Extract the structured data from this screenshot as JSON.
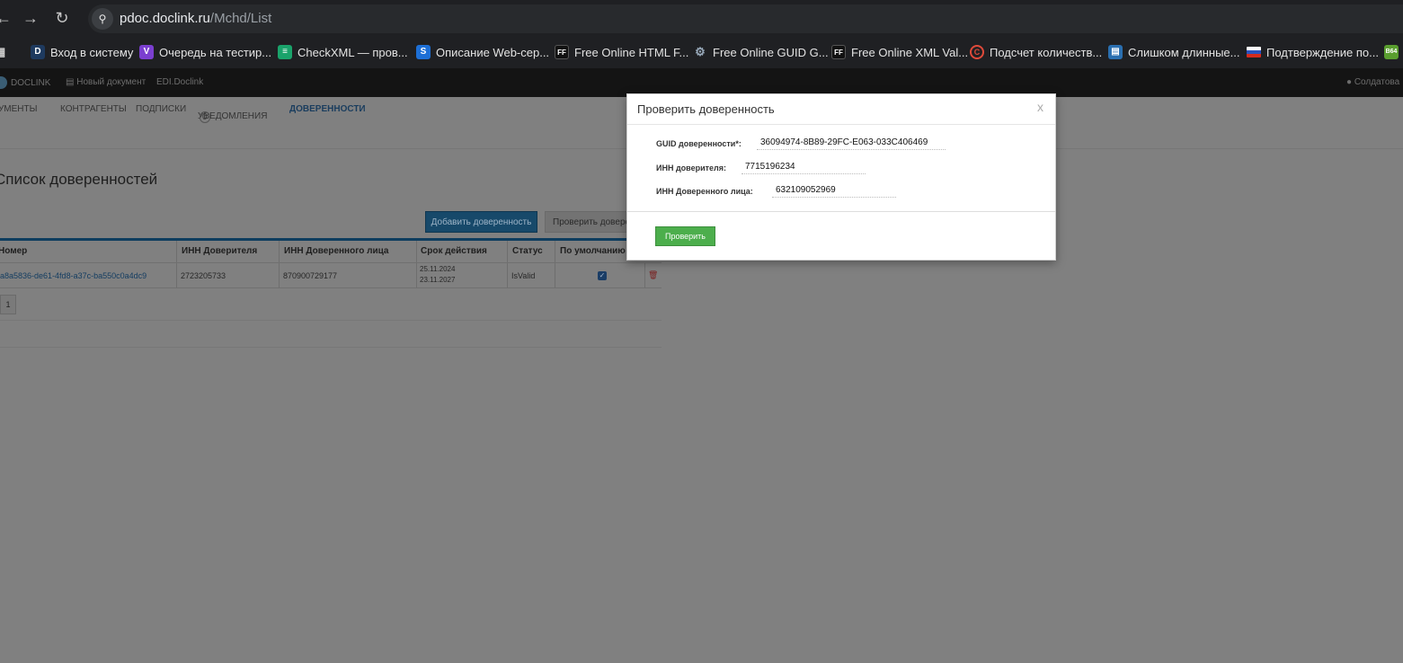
{
  "browser": {
    "url_host": "pdoc.doclink.ru",
    "url_path": "/Mchd/List",
    "bookmarks": [
      {
        "label": "Вход в систему",
        "icon": "D",
        "color": "#1e3a5f"
      },
      {
        "label": "Очередь на тестир...",
        "icon": "V",
        "color": "#7b3fd0"
      },
      {
        "label": "CheckXML — пров...",
        "icon": "≡",
        "color": "#1aa36b"
      },
      {
        "label": "Описание Web-сер...",
        "icon": "S",
        "color": "#1d6fd6"
      },
      {
        "label": "Free Online HTML F...",
        "icon": "FF",
        "color": "#111111"
      },
      {
        "label": "Free Online GUID G...",
        "icon": "⚙",
        "color": "#1f2023"
      },
      {
        "label": "Free Online XML Val...",
        "icon": "FF",
        "color": "#111111"
      },
      {
        "label": "Подсчет количеств...",
        "icon": "C",
        "color": "#c0392b"
      },
      {
        "label": "Слишком длинные...",
        "icon": "▤",
        "color": "#2a6fb0"
      },
      {
        "label": "Подтверждение по...",
        "icon": "",
        "color": "#d33"
      },
      {
        "label": "",
        "icon": "B64",
        "color": "#5a9e2f"
      }
    ]
  },
  "app": {
    "brand": "DOCLINK",
    "new_doc": "Новый документ",
    "edi": "EDI.Doclink",
    "user": "Солдатова"
  },
  "nav": {
    "documents": "КУМЕНТЫ",
    "contractors": "КОНТРАГЕНТЫ",
    "subscriptions": "ПОДПИСКИ",
    "notifications": "УВЕДОМЛЕНИЯ",
    "notifications_count": "0",
    "poa": "ДОВЕРЕННОСТИ"
  },
  "page": {
    "title": "Список доверенностей",
    "add_button": "Добавить доверенность",
    "check_button": "Проверить доверенность",
    "pager_page": "1"
  },
  "table": {
    "headers": [
      "Номер",
      "ИНН Доверителя",
      "ИНН Доверенного лица",
      "Срок действия",
      "Статус",
      "По умолчанию"
    ],
    "rows": [
      {
        "number": "a8a5836-de61-4fd8-a37c-ba550c0a4dc9",
        "inn_principal": "2723205733",
        "inn_attorney": "870900729177",
        "valid_from": "25.11.2024",
        "valid_to": "23.11.2027",
        "status": "IsValid",
        "is_default": true
      }
    ]
  },
  "modal": {
    "title": "Проверить доверенность",
    "close": "x",
    "guid_label": "GUID доверенности*:",
    "guid_value": "36094974-8B89-29FC-E063-033C406469",
    "inn_principal_label": "ИНН доверителя:",
    "inn_principal_value": "7715196234",
    "inn_attorney_label": "ИНН Доверенного лица:",
    "inn_attorney_value": "632109052969",
    "verify_button": "Проверить"
  }
}
